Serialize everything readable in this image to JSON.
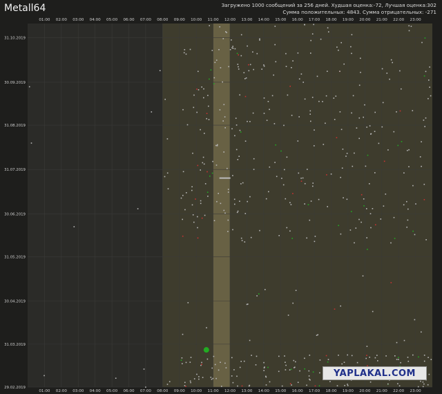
{
  "header": {
    "user": "Metall64",
    "stats_line_1": "Загружено 1000 сообщений за 256 дней. Худшая оценка:-72, Лучшая оценка:302",
    "stats_line_2": "Сумма положительных: 4843. Сумма отрицательных: -271"
  },
  "watermark": "YAPLAKAL.COM",
  "colors": {
    "background": "#1e1e1c",
    "plot_background": "#2b2b28",
    "grid": "#3b3b38",
    "highlight_band": "#45432f",
    "peak_band": "#6a6346",
    "neutral_point": "#b8b8b8",
    "positive_point": "#22aa22",
    "negative_point": "#c83232"
  },
  "chart_data": {
    "type": "scatter",
    "x_axis": {
      "unit": "hour of day",
      "range": [
        0,
        24
      ],
      "tick_labels": [
        "01:00",
        "02:00",
        "03:00",
        "04:00",
        "05:00",
        "06:00",
        "07:00",
        "08:00",
        "09:00",
        "10:00",
        "11:00",
        "12:00",
        "13:00",
        "14:00",
        "15:00",
        "16:00",
        "17:00",
        "18:00",
        "19:00",
        "20:00",
        "21:00",
        "22:00",
        "23:00"
      ],
      "position": "top and bottom"
    },
    "y_axis": {
      "unit": "date",
      "range": [
        "29.02.2019",
        "10.11.2019"
      ],
      "tick_labels": [
        "31.10.2019",
        "30.09.2019",
        "31.08.2019",
        "31.07.2019",
        "30.06.2019",
        "31.05.2019",
        "30.04.2019",
        "31.03.2019",
        "29.02.2019"
      ],
      "direction": "newest at top"
    },
    "bands": [
      {
        "from_hour": 8,
        "to_hour": 24,
        "kind": "active-hours"
      },
      {
        "from_hour": 11,
        "to_hour": 12,
        "kind": "peak-hour"
      }
    ],
    "notable_points": [
      {
        "hour": 10.6,
        "date": "27.03.2019",
        "sign": "positive",
        "size": "large"
      },
      {
        "hour": 11.7,
        "date": "25.07.2019",
        "sign": "neutral",
        "shape": "dash"
      }
    ],
    "grid": true,
    "total_messages": 1000,
    "days": 256
  }
}
